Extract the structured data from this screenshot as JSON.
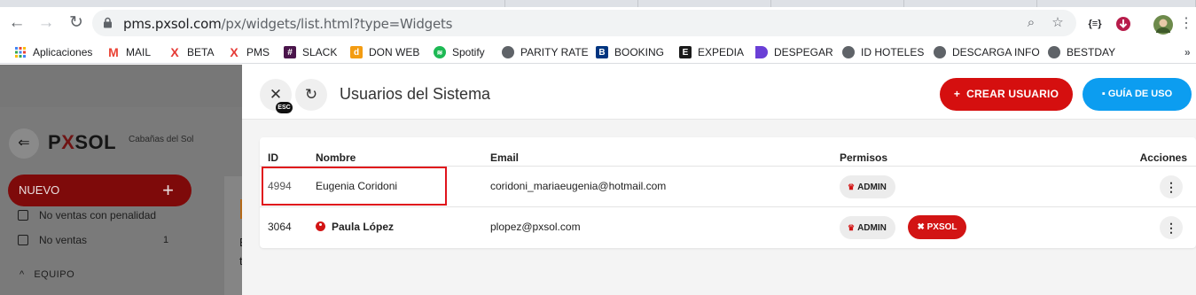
{
  "browser": {
    "url_host": "pms.pxsol.com",
    "url_path": "/px/widgets/list.html?type=Widgets",
    "ext_label": "{≡}",
    "bookmarks_overflow": "»"
  },
  "bookmarks": [
    {
      "label": "Aplicaciones",
      "icon": "apps-grid-icon",
      "color": "#4285f4",
      "glyph": "⋮⋮"
    },
    {
      "label": "MAIL",
      "icon": "gmail-icon",
      "color": "#ea4335",
      "glyph": "M"
    },
    {
      "label": "BETA",
      "icon": "x-red-icon",
      "color": "#e53935",
      "glyph": "X"
    },
    {
      "label": "PMS",
      "icon": "x-red-icon",
      "color": "#e53935",
      "glyph": "X"
    },
    {
      "label": "SLACK",
      "icon": "slack-icon",
      "color": "#4a154b",
      "glyph": "#"
    },
    {
      "label": "DON WEB",
      "icon": "donweb-icon",
      "color": "#f39c12",
      "glyph": "d"
    },
    {
      "label": "Spotify",
      "icon": "spotify-icon",
      "color": "#1db954",
      "glyph": "≋"
    },
    {
      "label": "PARITY RATE",
      "icon": "globe-icon",
      "color": "#5f6368",
      "glyph": "◍"
    },
    {
      "label": "BOOKING",
      "icon": "booking-icon",
      "color": "#003580",
      "glyph": "B"
    },
    {
      "label": "EXPEDIA",
      "icon": "expedia-icon",
      "color": "#1a1a1a",
      "glyph": "E"
    },
    {
      "label": "DESPEGAR",
      "icon": "despegar-icon",
      "color": "#6a3fd6",
      "glyph": "D"
    },
    {
      "label": "ID HOTELES",
      "icon": "globe-icon",
      "color": "#5f6368",
      "glyph": "◍"
    },
    {
      "label": "DESCARGA INFO",
      "icon": "globe-icon",
      "color": "#5f6368",
      "glyph": "◍"
    },
    {
      "label": "BESTDAY",
      "icon": "globe-icon",
      "color": "#5f6368",
      "glyph": "◍"
    }
  ],
  "sidebar": {
    "logo_left": "P",
    "logo_x": "X",
    "logo_right": "SOL",
    "hotel_name": "Cabañas del Sol",
    "nuevo_label": "NUEVO",
    "nuevo_plus": "+",
    "items": [
      {
        "label": "No ventas con penalidad",
        "count": ""
      },
      {
        "label": "No ventas",
        "count": "1"
      }
    ],
    "section_label": "EQUIPO",
    "section_chevron": "^",
    "bg_text_1": "E",
    "bg_text_2": "t"
  },
  "panel": {
    "title": "Usuarios del Sistema",
    "esc_label": "ESC",
    "create_button": "CREAR USUARIO",
    "create_plus": "+",
    "guide_button": "GUÍA DE USO",
    "columns": {
      "id": "ID",
      "name": "Nombre",
      "email": "Email",
      "permissions": "Permisos",
      "actions": "Acciones"
    },
    "rows": [
      {
        "id": "4994",
        "name": "Eugenia Coridoni",
        "email": "coridoni_mariaeugenia@hotmail.com",
        "badges": [
          "ADMIN"
        ],
        "is_pxsol": false
      },
      {
        "id": "3064",
        "name": "Paula López",
        "email": "plopez@pxsol.com",
        "badges": [
          "ADMIN",
          "PXSOL"
        ],
        "is_pxsol": true
      }
    ]
  },
  "colors": {
    "primary_red": "#d50f0f",
    "guide_blue": "#0c9df0",
    "highlight_red": "#e0141c"
  }
}
